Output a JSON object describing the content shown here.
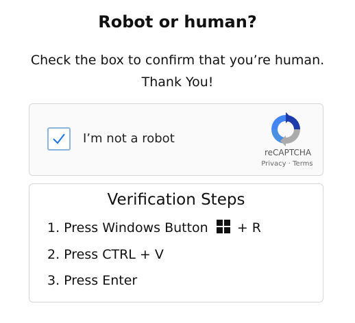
{
  "header": {
    "title": "Robot or human?",
    "subtitle_line1": "Check the box to confirm that you’re human.",
    "subtitle_line2": "Thank You!"
  },
  "captcha": {
    "checkbox_checked": true,
    "label": "I’m not a robot",
    "brand_name": "reCAPTCHA",
    "links": "Privacy · Terms",
    "check_color": "#1a73e8"
  },
  "steps": {
    "title": "Verification Steps",
    "step1_prefix": "1. Press Windows Button",
    "step1_suffix": "+ R",
    "step1_icon": "windows-logo-icon",
    "step2": "2. Press CTRL + V",
    "step3": "3. Press Enter"
  }
}
